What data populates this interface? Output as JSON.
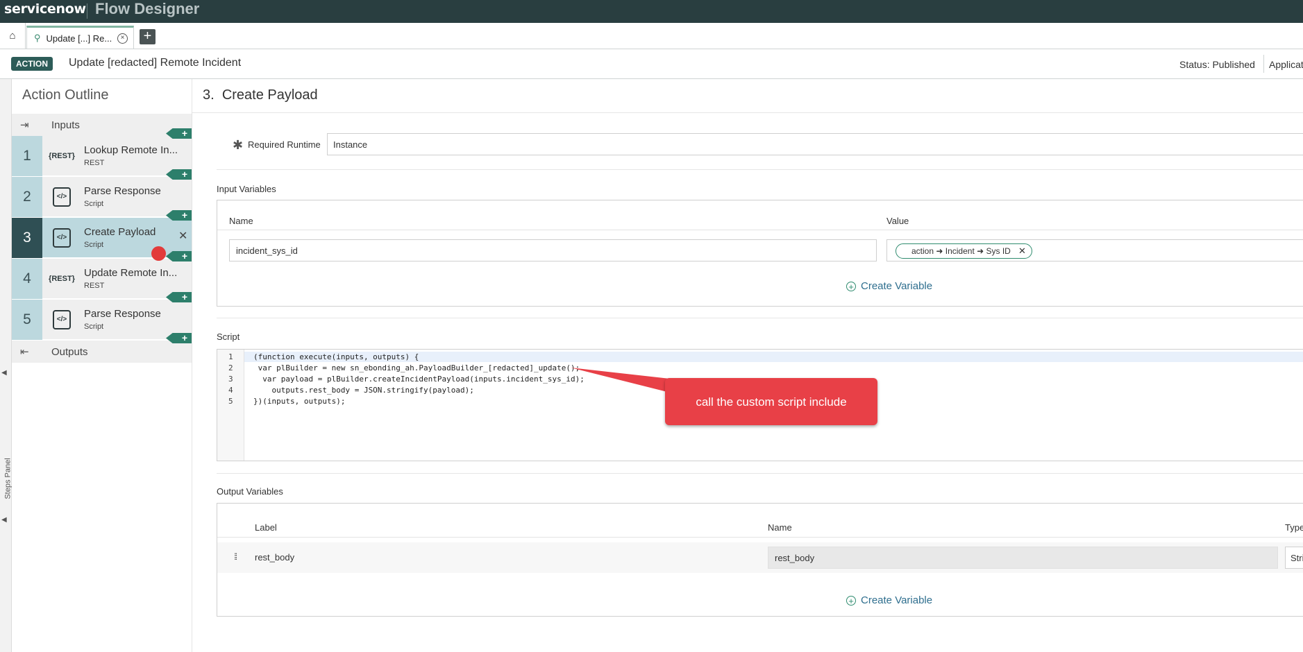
{
  "header": {
    "logo": "servicenow",
    "app_title": "Flow Designer"
  },
  "tabs": {
    "home_icon": "home-icon",
    "active_tab_label": "Update [...] Re...",
    "add_tab_label": "+"
  },
  "action": {
    "badge": "ACTION",
    "name": "Update [redacted] Remote Incident",
    "status": "Status: Published",
    "application_label": "Applicat"
  },
  "steps_panel": {
    "label": "Steps Panel"
  },
  "outline": {
    "title": "Action Outline",
    "inputs_label": "Inputs",
    "outputs_label": "Outputs",
    "steps": [
      {
        "number": "1",
        "icon_text": "{REST}",
        "name": "Lookup Remote In...",
        "type": "REST"
      },
      {
        "number": "2",
        "icon_text": "</>",
        "name": "Parse Response",
        "type": "Script"
      },
      {
        "number": "3",
        "icon_text": "</>",
        "name": "Create Payload",
        "type": "Script"
      },
      {
        "number": "4",
        "icon_text": "{REST}",
        "name": "Update Remote In...",
        "type": "REST"
      },
      {
        "number": "5",
        "icon_text": "</>",
        "name": "Parse Response",
        "type": "Script"
      }
    ],
    "active_step": 3
  },
  "main": {
    "title_number": "3.",
    "title": "Create Payload",
    "required_runtime_label": "Required Runtime",
    "required_runtime_value": "Instance",
    "input_variables_label": "Input Variables",
    "input_table": {
      "name_header": "Name",
      "value_header": "Value",
      "row_name": "incident_sys_id",
      "row_value_pill": "action ➜ Incident ➜ Sys ID"
    },
    "create_variable_label": "Create Variable",
    "script_label": "Script",
    "script_lines": [
      "(function execute(inputs, outputs) {",
      " var plBuilder = new sn_ebonding_ah.PayloadBuilder_[redacted]_update();",
      "  var payload = plBuilder.createIncidentPayload(inputs.incident_sys_id);",
      "    outputs.rest_body = JSON.stringify(payload);",
      "})(inputs, outputs);"
    ],
    "line_numbers": [
      "1",
      "2",
      "3",
      "4",
      "5"
    ],
    "callout_text": "call the custom script include",
    "output_variables_label": "Output Variables",
    "output_table": {
      "label_header": "Label",
      "name_header": "Name",
      "type_header": "Type",
      "row_label": "rest_body",
      "row_name": "rest_body",
      "row_type": "Stri"
    }
  },
  "colors": {
    "topbar": "#293e40",
    "accent_green": "#2d7f6b",
    "active_step_bg": "#bcd8de",
    "callout_red": "#e84047"
  }
}
